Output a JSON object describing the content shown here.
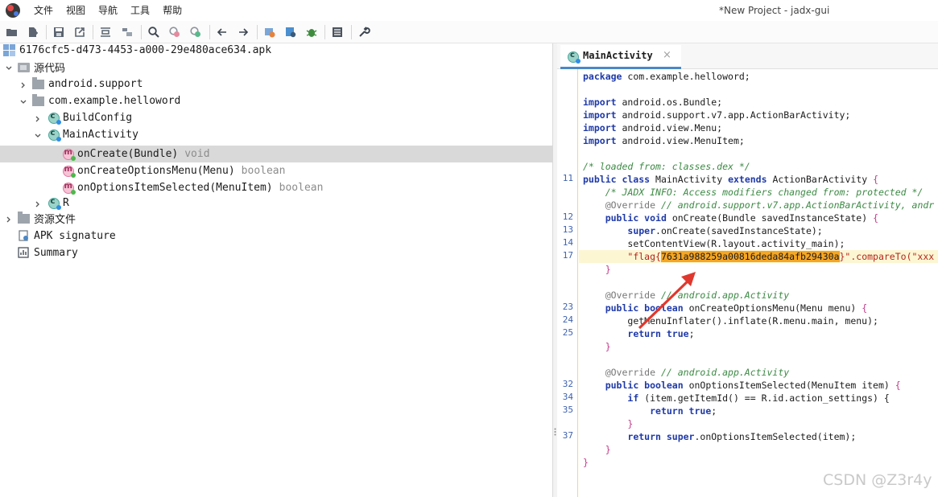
{
  "menubar": {
    "items": [
      "文件",
      "视图",
      "导航",
      "工具",
      "帮助"
    ]
  },
  "window_title": "*New Project - jadx-gui",
  "toolbar": {
    "icons": [
      "open-folder-icon",
      "add-file-icon",
      "save-icon",
      "export-icon",
      "sync-icon",
      "tree-icon",
      "search-icon",
      "find-class-icon",
      "find-usage-icon",
      "back-icon",
      "forward-icon",
      "decompile-icon",
      "deobfuscation-icon",
      "debug-icon",
      "log-icon",
      "preferences-icon"
    ]
  },
  "tree": {
    "root": "6176cfc5-d473-4453-a000-29e480ace634.apk",
    "source_code": "源代码",
    "pkg_android_support": "android.support",
    "pkg_main": "com.example.helloword",
    "class_buildconfig": "BuildConfig",
    "class_mainactivity": "MainActivity",
    "methods": [
      {
        "name": "onCreate(Bundle)",
        "type": "void"
      },
      {
        "name": "onCreateOptionsMenu(Menu)",
        "type": "boolean"
      },
      {
        "name": "onOptionsItemSelected(MenuItem)",
        "type": "boolean"
      }
    ],
    "class_r": "R",
    "resources": "资源文件",
    "apk_signature": "APK signature",
    "summary": "Summary"
  },
  "editor": {
    "tab_label": "MainActivity",
    "tab_close": "×",
    "line_numbers": {
      "l11": "11",
      "l12": "12",
      "l13": "13",
      "l14": "14",
      "l17": "17",
      "l23": "23",
      "l24": "24",
      "l25": "25",
      "l32": "32",
      "l34": "34",
      "l35": "35",
      "l37": "37"
    },
    "code": {
      "package_stmt": "com.example.helloword;",
      "imports": [
        "android.os.Bundle;",
        "android.support.v7.app.ActionBarActivity;",
        "android.view.Menu;",
        "android.view.MenuItem;"
      ],
      "loaded_comment": "/* loaded from: classes.dex */",
      "class_name": "MainActivity",
      "super_class": "ActionBarActivity",
      "jadx_info": "/* JADX INFO: Access modifiers changed from: protected */",
      "override_comment_1": "// android.support.v7.app.ActionBarActivity, andr",
      "oncreate_sig": "onCreate(Bundle savedInstanceState)",
      "super_oncreate": ".onCreate(savedInstanceState);",
      "set_content": "setContentView(R.layout.activity_main);",
      "flag_prefix": "\"flag{",
      "flag_value": "7631a988259a00816deda84afb29430a",
      "flag_suffix": "}\".compareTo(\"xxx",
      "override_comment_2": "// android.app.Activity",
      "oncreateoptions_sig": "onCreateOptionsMenu(Menu menu)",
      "inflate_line": "getMenuInflater().inflate(R.menu.main, menu);",
      "override_comment_3": "// android.app.Activity",
      "onoptions_sig": "onOptionsItemSelected(MenuItem item)",
      "if_line": "(item.getItemId() == R.id.action_settings) {",
      "return_super": ".onOptionsItemSelected(item);"
    }
  },
  "watermark": "CSDN @Z3r4y",
  "colors": {
    "selection": "#d9d9d9",
    "flag_highlight": "#f5a623",
    "arrow": "#e0382e",
    "keyword": "#1f3aa8",
    "comment": "#3c8a44"
  }
}
